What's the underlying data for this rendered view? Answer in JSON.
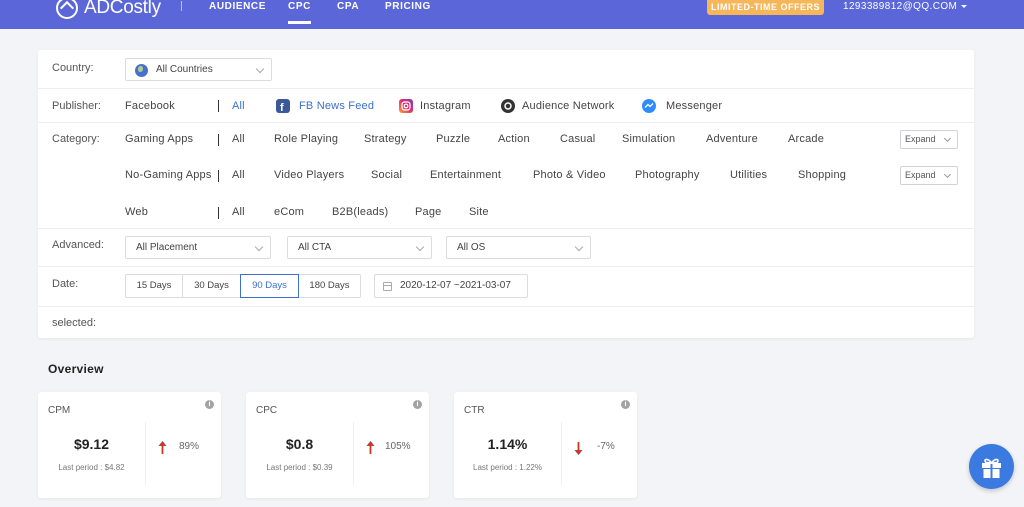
{
  "header": {
    "brand": "ADCostly",
    "nav": [
      "AUDIENCE",
      "CPC",
      "CPA",
      "PRICING"
    ],
    "active_nav": "CPC",
    "offer": "LIMITED-TIME OFFERS",
    "email": "1293389812@QQ.COM",
    "colors": {
      "bar": "#5b67d8",
      "offer": "#f6b65a"
    }
  },
  "filters": {
    "country": {
      "label": "Country:",
      "value": "All Countries"
    },
    "publisher": {
      "label": "Publisher:",
      "group": "Facebook",
      "options": [
        "All",
        "FB News Feed",
        "Instagram",
        "Audience Network",
        "Messenger"
      ],
      "selected": [
        "All",
        "FB News Feed"
      ]
    },
    "category": {
      "label": "Category:",
      "gaming": {
        "label": "Gaming Apps",
        "options": [
          "All",
          "Role Playing",
          "Strategy",
          "Puzzle",
          "Action",
          "Casual",
          "Simulation",
          "Adventure",
          "Arcade"
        ],
        "expand": "Expand"
      },
      "nongaming": {
        "label": "No-Gaming Apps",
        "options": [
          "All",
          "Video Players",
          "Social",
          "Entertainment",
          "Photo & Video",
          "Photography",
          "Utilities",
          "Shopping"
        ],
        "expand": "Expand"
      },
      "web": {
        "label": "Web",
        "options": [
          "All",
          "eCom",
          "B2B(leads)",
          "Page",
          "Site"
        ]
      }
    },
    "advanced": {
      "label": "Advanced:",
      "placement": "All Placement",
      "cta": "All CTA",
      "os": "All OS"
    },
    "date": {
      "label": "Date:",
      "options": [
        "15 Days",
        "30 Days",
        "90 Days",
        "180 Days"
      ],
      "active": "90 Days",
      "range": "2020-12-07 ~2021-03-07"
    },
    "selected_label": "selected:"
  },
  "overview": {
    "title": "Overview",
    "cards": [
      {
        "title": "CPM",
        "value": "$9.12",
        "last": "Last period : $4.82",
        "change": "89%",
        "direction": "up"
      },
      {
        "title": "CPC",
        "value": "$0.8",
        "last": "Last period : $0.39",
        "change": "105%",
        "direction": "up"
      },
      {
        "title": "CTR",
        "value": "1.14%",
        "last": "Last period : 1.22%",
        "change": "-7%",
        "direction": "down"
      }
    ]
  },
  "icons": {
    "globe": "globe-icon",
    "facebook": "facebook-icon",
    "instagram": "instagram-icon",
    "audience_network": "audience-network-icon",
    "messenger": "messenger-icon",
    "calendar": "calendar-icon",
    "info": "info-icon",
    "gift": "gift-icon"
  }
}
